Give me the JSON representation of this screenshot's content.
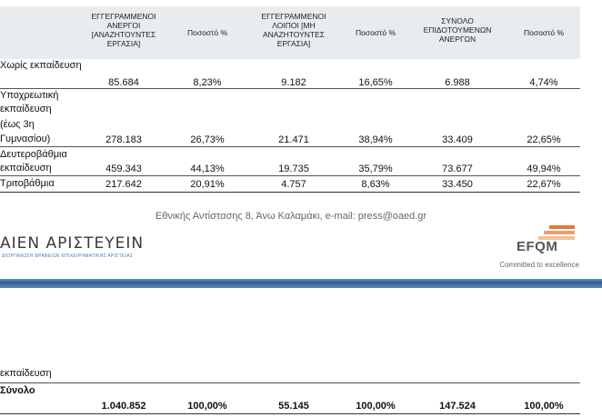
{
  "table": {
    "headers": [
      "ΕΓΓΕΓΡΑΜΜΕΝΟΙ ΑΝΕΡΓΟΙ [ΑΝΑΖΗΤΟΥΝΤΕΣ ΕΡΓΑΣΙΑ]",
      "Ποσοστό %",
      "ΕΓΓΕΓΡΑΜΜΕΝΟΙ ΛΟΙΠΟΙ [ΜΗ ΑΝΑΖΗΤΟΥΝΤΕΣ ΕΡΓΑΣΙΑ]",
      "Ποσοστό %",
      "ΣΥΝΟΛΟ ΕΠΙΔΟΤΟΥΜΕΝΩΝ ΑΝΕΡΓΩΝ",
      "Ποσοστό %"
    ],
    "rows": [
      {
        "label_lines": [
          "Χωρίς εκπαίδευση"
        ],
        "values": [
          "85.684",
          "8,23%",
          "9.182",
          "16,65%",
          "6.988",
          "4,74%"
        ]
      },
      {
        "label_lines": [
          "Υποχρεωτική",
          "εκπαίδευση",
          "(έως 3η",
          "Γυμνασίου)"
        ],
        "values": [
          "278.183",
          "26,73%",
          "21.471",
          "38,94%",
          "33.409",
          "22,65%"
        ]
      },
      {
        "label_lines": [
          "Δευτεροβάθμια",
          "εκπαίδευση"
        ],
        "values": [
          "459.343",
          "44,13%",
          "19.735",
          "35,79%",
          "73.677",
          "49,94%"
        ]
      },
      {
        "label_lines": [
          "Τριτοβάθμια"
        ],
        "values": [
          "217.642",
          "20,91%",
          "4.757",
          "8,63%",
          "33.450",
          "22,67%"
        ]
      }
    ]
  },
  "footer": {
    "address": "Εθνικής Αντίστασης 8,  Άνω Καλαμάκι, e-mail: press@oaed.gr",
    "award_logo": "ΑΙΕΝ ΑΡΙΣΤΕΥΕΙΝ",
    "award_sub": "ΔΙΟΡΓΑΝΩΣΗ ΒΡΑΒΕΙΩΝ ΕΠΙΧΕΙΡΗΜΑΤΙΚΗΣ ΑΡΙΣΤΕΙΑΣ",
    "efqm_logo": "EFQM",
    "efqm_tagline": "Committed to excellence"
  },
  "page2": {
    "label_top": "εκπαίδευση",
    "total_label": "Σύνολο",
    "total_values": [
      "1.040.852",
      "100,00%",
      "55.145",
      "100,00%",
      "147.524",
      "100,00%"
    ]
  },
  "colors": {
    "header_band": "#e8ecef",
    "divider_band": "#2c5f8f",
    "efqm_orange": "#e07a3a"
  }
}
